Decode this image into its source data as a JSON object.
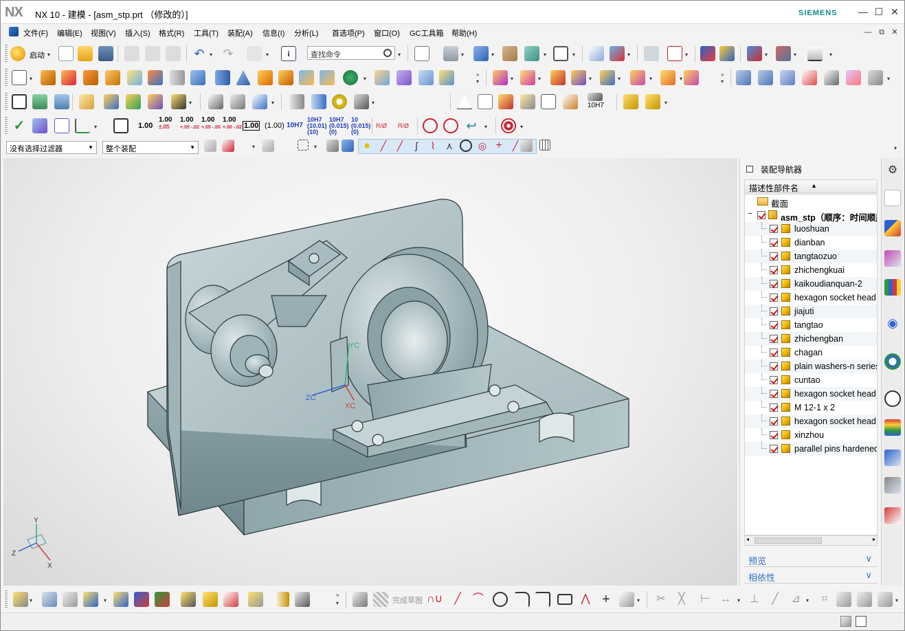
{
  "window": {
    "title": "NX 10 - 建模 - [asm_stp.prt （修改的）]",
    "logo": "NX",
    "brand": "SIEMENS"
  },
  "menu": [
    "文件(F)",
    "编辑(E)",
    "视图(V)",
    "插入(S)",
    "格式(R)",
    "工具(T)",
    "装配(A)",
    "信息(I)",
    "分析(L)",
    "首选项(P)",
    "窗口(O)",
    "GC工具箱",
    "帮助(H)"
  ],
  "toolbar1": {
    "start_label": "启动",
    "search_placeholder": "查找命令"
  },
  "toolbar2": {
    "dim_labels": [
      "1.00",
      "1.00 ±.05",
      "1.00 +.05 -.02",
      "1.00 +.05 -.00",
      "1.00 +.00 -.02",
      "1.00",
      "(1.00)",
      "10H7",
      "10H7 (10.01) (10)",
      "10H7 (10.015) (0)",
      "10 (0.015) (0)"
    ],
    "fit_label": "10H7"
  },
  "selection": {
    "filter": "没有选择过滤器",
    "scope": "整个装配"
  },
  "navigator": {
    "title": "装配导航器",
    "column": "描述性部件名",
    "section_node": "截面",
    "root": "asm_stp（顺序：时间顺序）",
    "parts": [
      "luoshuan",
      "dianban",
      "tangtaozuo",
      "zhichengkuai",
      "kaikoudianquan-2",
      "hexagon socket head",
      "jiajuti",
      "tangtao",
      "zhichengban",
      "chagan",
      "plain washers-n series",
      "cuntao",
      "hexagon socket head",
      "M 12-1 x 2",
      "hexagon socket head",
      "xinzhou",
      "parallel pins hardened"
    ],
    "panels": [
      "预览",
      "相依性"
    ]
  },
  "viewport": {
    "axis_labels": [
      "YC",
      "ZC",
      "XC"
    ],
    "triad_labels": [
      "Z",
      "X",
      "Y"
    ]
  },
  "bottom": {
    "sketch_finish": "完成草图"
  },
  "colors": {
    "accent": "#3372c4",
    "brand": "#0b8c8c",
    "check": "#d21414",
    "model": "#a8bfc4"
  }
}
